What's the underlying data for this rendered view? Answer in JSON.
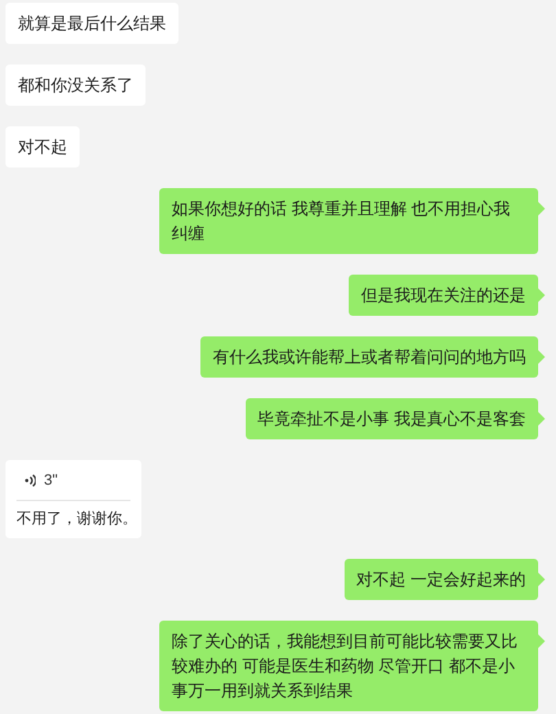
{
  "messages": [
    {
      "kind": "text",
      "outgoing": false,
      "text": "就算是最后什么结果"
    },
    {
      "kind": "text",
      "outgoing": false,
      "text": "都和你没关系了"
    },
    {
      "kind": "text",
      "outgoing": false,
      "text": "对不起"
    },
    {
      "kind": "text",
      "outgoing": true,
      "text": "如果你想好的话 我尊重并且理解 也不用担心我纠缠"
    },
    {
      "kind": "text",
      "outgoing": true,
      "text": "但是我现在关注的还是"
    },
    {
      "kind": "text",
      "outgoing": true,
      "text": "有什么我或许能帮上或者帮着问问的地方吗"
    },
    {
      "kind": "text",
      "outgoing": true,
      "text": "毕竟牵扯不是小事 我是真心不是客套"
    },
    {
      "kind": "voice",
      "outgoing": false,
      "duration": "3\"",
      "transcript": "不用了，谢谢你。"
    },
    {
      "kind": "text",
      "outgoing": true,
      "text": "对不起 一定会好起来的"
    },
    {
      "kind": "text",
      "outgoing": true,
      "text": "除了关心的话，我能想到目前可能比较需要又比较难办的 可能是医生和药物 尽管开口 都不是小事万一用到就关系到结果"
    }
  ]
}
